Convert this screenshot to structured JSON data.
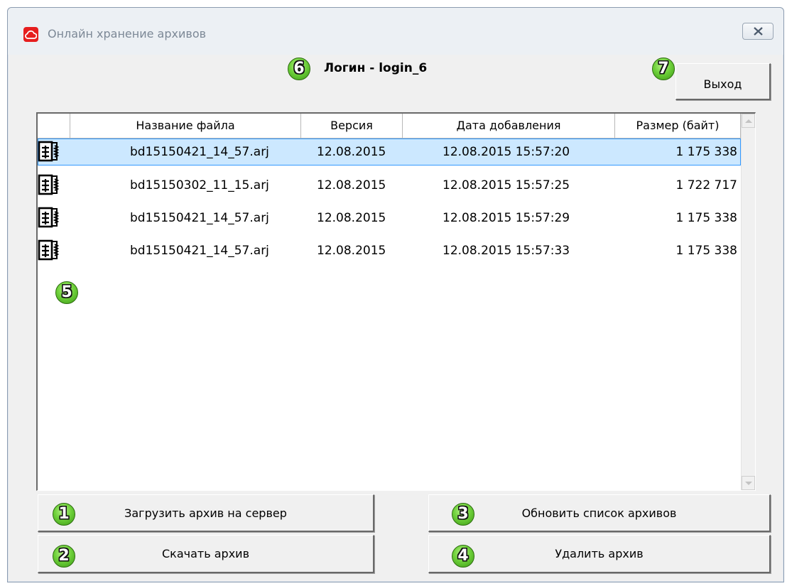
{
  "window": {
    "title": "Онлайн хранение архивов",
    "icon": "cloud-icon",
    "close_icon": "close-icon",
    "accent": "#e61e1e"
  },
  "header": {
    "login_label": "Логин - login_6",
    "exit_label": "Выход"
  },
  "badges": {
    "b1": "1",
    "b2": "2",
    "b3": "3",
    "b4": "4",
    "b5": "5",
    "b6": "6",
    "b7": "7"
  },
  "table": {
    "columns": [
      "Название файла",
      "Версия",
      "Дата добавления",
      "Размер (байт)"
    ],
    "rows": [
      {
        "icon": "archive-icon",
        "name": "bd15150421_14_57.arj",
        "version": "12.08.2015",
        "added": "12.08.2015 15:57:20",
        "size": "1 175 338",
        "selected": true
      },
      {
        "icon": "archive-icon",
        "name": "bd15150302_11_15.arj",
        "version": "12.08.2015",
        "added": "12.08.2015 15:57:25",
        "size": "1 722 717",
        "selected": false
      },
      {
        "icon": "archive-icon",
        "name": "bd15150421_14_57.arj",
        "version": "12.08.2015",
        "added": "12.08.2015 15:57:29",
        "size": "1 175 338",
        "selected": false
      },
      {
        "icon": "archive-icon",
        "name": "bd15150421_14_57.arj",
        "version": "12.08.2015",
        "added": "12.08.2015 15:57:33",
        "size": "1 175 338",
        "selected": false
      }
    ]
  },
  "actions": {
    "upload": "Загрузить архив на сервер",
    "refresh": "Обновить список архивов",
    "download": "Скачать архив",
    "delete": "Удалить архив"
  },
  "colors": {
    "selection_bg": "#cce8ff",
    "selection_border": "#3399ff",
    "badge_green": "#6fd13b"
  }
}
